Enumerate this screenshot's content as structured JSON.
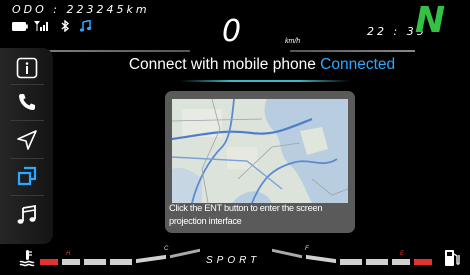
{
  "top": {
    "odometer": "ODO : 223245km",
    "speed": "0",
    "speed_unit": "km/h",
    "time": "22 : 35",
    "gear": "N"
  },
  "colors": {
    "accent_blue": "#2ea7ff",
    "gear_green": "#33c243",
    "warning_red": "#e23232"
  },
  "status_icons": [
    "battery-icon",
    "signal-icon",
    "bluetooth-icon",
    "music-note-icon"
  ],
  "sidebar": {
    "items": [
      {
        "icon": "info-icon"
      },
      {
        "icon": "phone-icon"
      },
      {
        "icon": "navigation-icon"
      },
      {
        "icon": "screen-projection-icon",
        "active": true
      },
      {
        "icon": "music-icon"
      }
    ]
  },
  "main": {
    "title": "Connect with mobile phone",
    "status": "Connected",
    "card_text": "Click the ENT button to enter the screen projection interface"
  },
  "bottom": {
    "mode": "SPORT",
    "left_marker": "C",
    "right_marker": "F",
    "left_red_marker": "H",
    "right_red_marker": "E",
    "left_icon": "coolant-temperature-icon",
    "right_icon": "fuel-pump-icon"
  }
}
